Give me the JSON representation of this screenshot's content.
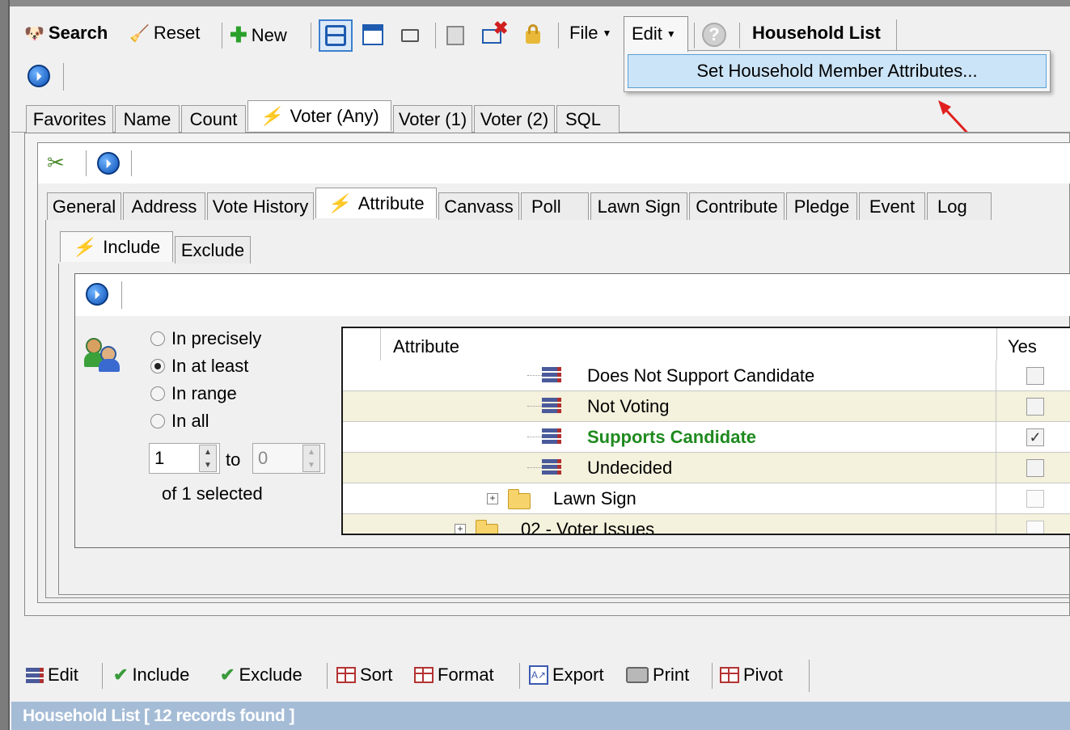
{
  "toolbar": {
    "search": "Search",
    "reset": "Reset",
    "new": "New",
    "file": "File",
    "edit": "Edit",
    "window_title": "Household List"
  },
  "edit_menu": {
    "item": "Set Household Member Attributes..."
  },
  "main_tabs": [
    "Favorites",
    "Name",
    "Count",
    "Voter (Any)",
    "Voter (1)",
    "Voter (2)",
    "SQL"
  ],
  "voter_tabs": [
    "General",
    "Address",
    "Vote History",
    "Attribute",
    "Canvass",
    "Poll",
    "Lawn Sign",
    "Contribute",
    "Pledge",
    "Event",
    "Log"
  ],
  "include_tabs": [
    "Include",
    "Exclude"
  ],
  "match_options": {
    "precisely": "In precisely",
    "at_least": "In at least",
    "range": "In range",
    "all": "In all",
    "selected": "at_least"
  },
  "range": {
    "from": "1",
    "to_label": "to",
    "to": "0",
    "of_selected": "of 1 selected"
  },
  "grid": {
    "col_attribute": "Attribute",
    "col_yes": "Yes",
    "rows": [
      {
        "label": "Does Not Support Candidate",
        "checked": false,
        "kind": "attribute"
      },
      {
        "label": "Not Voting",
        "checked": false,
        "kind": "attribute"
      },
      {
        "label": "Supports Candidate",
        "checked": true,
        "kind": "attribute",
        "highlight_color": "#1f8a1f"
      },
      {
        "label": "Undecided",
        "checked": false,
        "kind": "attribute"
      },
      {
        "label": "Lawn Sign",
        "checked": false,
        "kind": "folder"
      },
      {
        "label": "02 - Voter Issues",
        "checked": false,
        "kind": "folder"
      }
    ]
  },
  "bottom_toolbar": {
    "edit": "Edit",
    "include": "Include",
    "exclude": "Exclude",
    "sort": "Sort",
    "format": "Format",
    "export": "Export",
    "print": "Print",
    "pivot": "Pivot"
  },
  "status": {
    "text": "Household List [ 12 records found ]"
  },
  "colors": {
    "status_bar": "#a5bcd6",
    "menu_highlight": "#cce4f7",
    "row_alt": "#f4f1dc",
    "arrow": "#e02020"
  }
}
